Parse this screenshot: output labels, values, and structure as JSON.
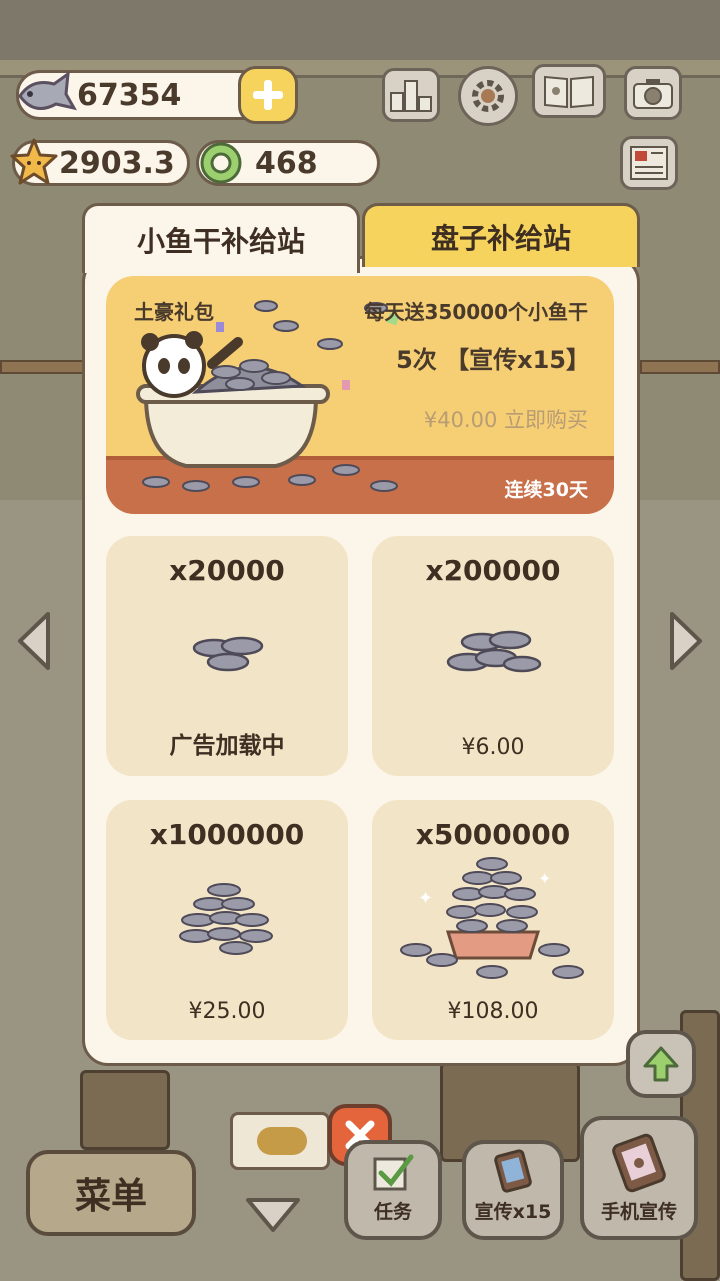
{
  "hud": {
    "fish_count": "67354",
    "star_value": "2903.3",
    "ring_count": "468"
  },
  "tabs": {
    "fish_station": "小鱼干补给站",
    "plate_station": "盘子补给站"
  },
  "gift": {
    "title": "土豪礼包",
    "desc": "每天送350000个小鱼干",
    "times": "5次 【宣传x15】",
    "price": "¥40.00 立即购买",
    "days": "连续30天"
  },
  "items": [
    {
      "qty": "x20000",
      "price": "广告加载中"
    },
    {
      "qty": "x200000",
      "price": "¥6.00"
    },
    {
      "qty": "x1000000",
      "price": "¥25.00"
    },
    {
      "qty": "x5000000",
      "price": "¥108.00"
    }
  ],
  "bottom": {
    "menu": "菜单",
    "task": "任务",
    "promo": "宣传x15",
    "phone_promo": "手机宣传"
  },
  "colors": {
    "accent_yellow": "#f6d35c",
    "panel_bg": "#fbf5ea",
    "item_bg": "#f2e5c7",
    "close_red": "#e4653c",
    "outline": "#6d5c4a"
  },
  "icons": [
    "fish-icon",
    "plus-icon",
    "star-icon",
    "ring-icon",
    "ranking-icon",
    "gear-icon",
    "book-icon",
    "camera-icon",
    "newspaper-icon",
    "close-icon",
    "check-icon",
    "arrow-left-icon",
    "arrow-right-icon",
    "arrow-down-icon",
    "arrow-up-icon"
  ]
}
